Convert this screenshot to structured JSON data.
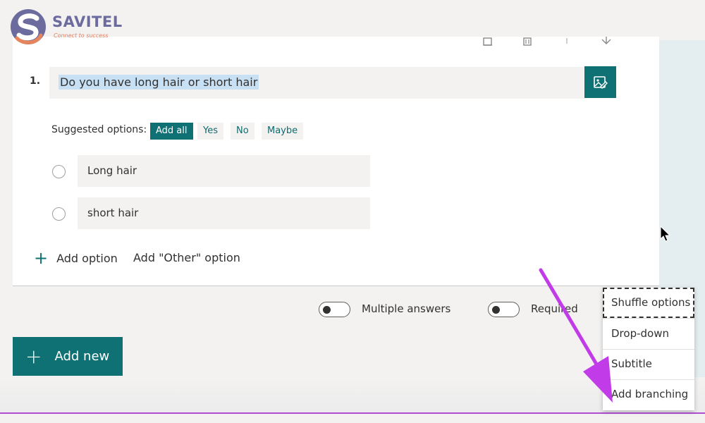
{
  "logo": {
    "name": "SAVITEL",
    "tagline": "Connect to success"
  },
  "question": {
    "number": "1.",
    "title": "Do you have long hair or short hair"
  },
  "suggested": {
    "label": "Suggested options:",
    "add_all": "Add all",
    "chips": [
      "Yes",
      "No",
      "Maybe"
    ]
  },
  "options": [
    "Long hair",
    "short hair"
  ],
  "add_option": "Add option",
  "add_other": "Add \"Other\" option",
  "toggles": {
    "multiple_answers": "Multiple answers",
    "required": "Required"
  },
  "add_new": "Add new",
  "menu": {
    "items": [
      "Shuffle options",
      "Drop-down",
      "Subtitle",
      "Add branching"
    ]
  },
  "colors": {
    "accent": "#0f7173",
    "annotation_arrow": "#c13ce8"
  },
  "icons": [
    "copy-icon",
    "delete-icon",
    "move-up-icon",
    "move-down-icon",
    "image-edit-icon",
    "plus-icon",
    "mouse-cursor-icon"
  ]
}
